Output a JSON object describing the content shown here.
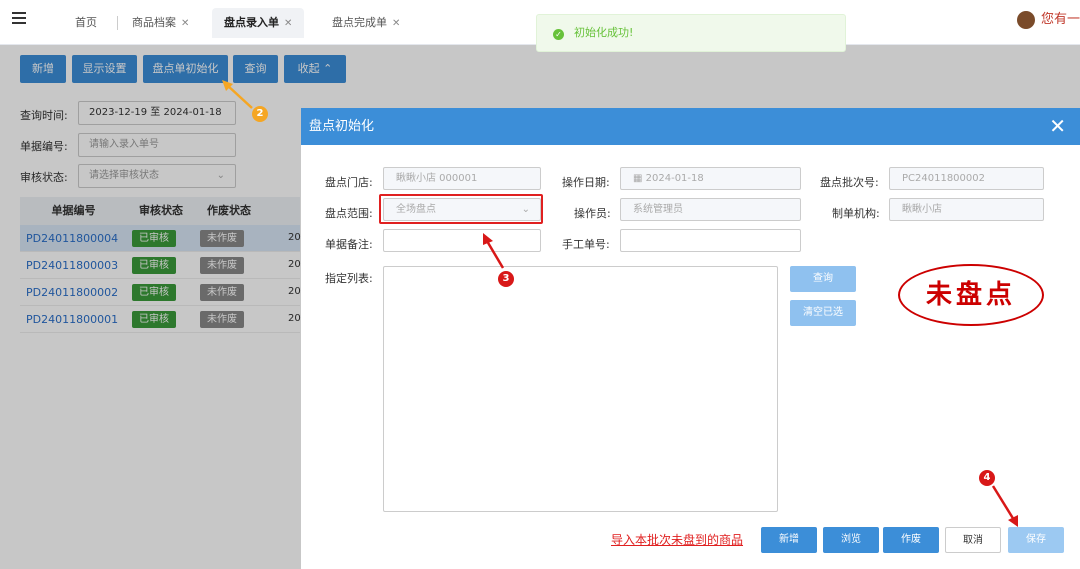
{
  "tabs": [
    {
      "label": "首页",
      "closable": false
    },
    {
      "label": "商品档案",
      "closable": true
    },
    {
      "label": "盘点录入单",
      "closable": true,
      "active": true
    },
    {
      "label": "盘点完成单",
      "closable": true
    }
  ],
  "user": {
    "label": "您有一"
  },
  "toast": {
    "message": "初始化成功!"
  },
  "toolbar": {
    "new": "新增",
    "display_settings": "显示设置",
    "init": "盘点单初始化",
    "query": "查询",
    "collapse": "收起 ⌃"
  },
  "filters": {
    "date_label": "查询时间:",
    "date_value": "2023-12-19  至  2024-01-18",
    "doc_no_label": "单据编号:",
    "doc_no_placeholder": "请输入录入单号",
    "audit_label": "审核状态:",
    "audit_placeholder": "请选择审核状态"
  },
  "table": {
    "headers": [
      "单据编号",
      "审核状态",
      "作废状态"
    ],
    "rows": [
      {
        "no": "PD24011800004",
        "audit": "已审核",
        "void": "未作废",
        "date": "20"
      },
      {
        "no": "PD24011800003",
        "audit": "已审核",
        "void": "未作废",
        "date": "20"
      },
      {
        "no": "PD24011800002",
        "audit": "已审核",
        "void": "未作废",
        "date": "20"
      },
      {
        "no": "PD24011800001",
        "audit": "已审核",
        "void": "未作废",
        "date": "20"
      }
    ]
  },
  "modal": {
    "title": "盘点初始化",
    "store_label": "盘点门店:",
    "store_value": "瞅瞅小店 000001",
    "op_date_label": "操作日期:",
    "op_date_value": "2024-01-18",
    "batch_label": "盘点批次号:",
    "batch_value": "PC24011800002",
    "scope_label": "盘点范围:",
    "scope_value": "全场盘点",
    "operator_label": "操作员:",
    "operator_value": "系统管理员",
    "org_label": "制单机构:",
    "org_value": "瞅瞅小店",
    "remark_label": "单据备注:",
    "manual_no_label": "手工单号:",
    "list_label": "指定列表:",
    "query_btn": "查询",
    "clear_btn": "清空已选",
    "stamp": "未盘点",
    "import_link": "导入本批次未盘到的商品",
    "new_btn": "新增",
    "browse_btn": "浏览",
    "void_btn": "作废",
    "cancel_btn": "取消",
    "save_btn": "保存"
  },
  "markers": [
    "2",
    "3",
    "4"
  ],
  "colors": {
    "primary": "#3c8ed8",
    "success": "#3a9a3a",
    "annotation_red": "#d81818",
    "annotation_yellow": "#f5a623"
  }
}
